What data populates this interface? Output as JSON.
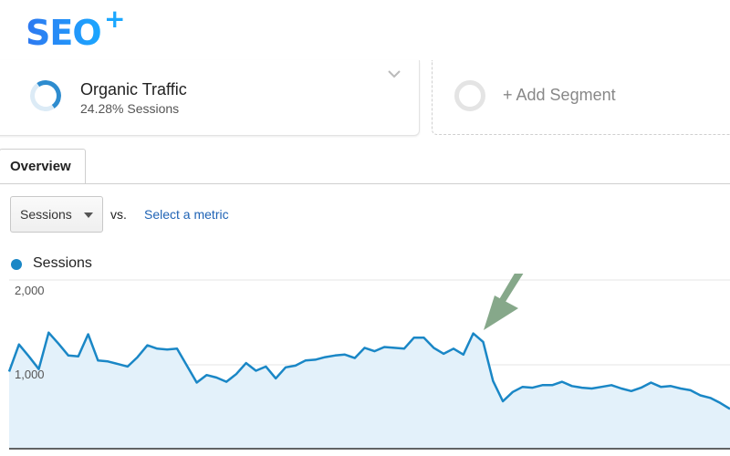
{
  "logo": {
    "text": "SEO",
    "plus": "+"
  },
  "segments": {
    "active": {
      "title": "Organic Traffic",
      "subtitle": "24.28% Sessions",
      "percent": 24.28
    },
    "add_label": "+ Add Segment"
  },
  "tabs": [
    {
      "label": "Overview"
    }
  ],
  "controls": {
    "metric": "Sessions",
    "vs": "vs.",
    "secondary_link": "Select a metric"
  },
  "legend": {
    "label": "Sessions",
    "color": "#1a87c6"
  },
  "colors": {
    "line": "#1a87c6",
    "fill": "#e3f1fa",
    "arrow": "#86a88a",
    "link": "#1f63b5"
  },
  "chart_data": {
    "type": "area",
    "yticks": [
      "2,000",
      "1,000"
    ],
    "ylim": [
      0,
      2000
    ],
    "grid": true,
    "annotation": "arrow pointing to peak before drop",
    "series": [
      {
        "values": [
          920,
          1240,
          1100,
          950,
          1380,
          1250,
          1110,
          1100,
          1360,
          1050,
          1040,
          1010,
          980,
          1090,
          1230,
          1190,
          1180,
          1190,
          990,
          790,
          880,
          850,
          800,
          890,
          1020,
          930,
          980,
          840,
          970,
          990,
          1050,
          1060,
          1090,
          1110,
          1120,
          1080,
          1200,
          1160,
          1210,
          1200,
          1190,
          1320,
          1320,
          1200,
          1130,
          1190,
          1120,
          1370,
          1270,
          810,
          570,
          680,
          740,
          730,
          760,
          760,
          800,
          750,
          730,
          720,
          740,
          760,
          720,
          690,
          730,
          790,
          740,
          750,
          720,
          700,
          640,
          610,
          550,
          480
        ]
      }
    ]
  }
}
